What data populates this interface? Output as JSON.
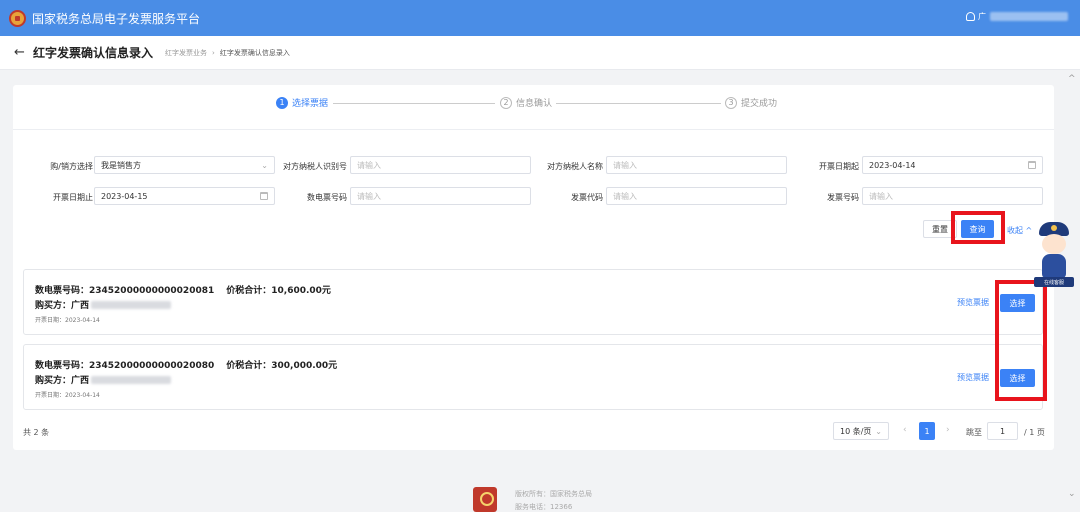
{
  "header": {
    "title": "国家税务总局电子发票服务平台",
    "user_prefix": "广"
  },
  "page": {
    "title": "红字发票确认信息录入",
    "breadcrumb": [
      "红字发票业务",
      "红字发票确认信息录入"
    ]
  },
  "steps": [
    {
      "num": "1",
      "label": "选择票据"
    },
    {
      "num": "2",
      "label": "信息确认"
    },
    {
      "num": "3",
      "label": "提交成功"
    }
  ],
  "form": {
    "buy_sell_label": "购/销方选择",
    "buy_sell_value": "我是销售方",
    "tax_id_label": "对方纳税人识别号",
    "tax_id_placeholder": "请输入",
    "name_label": "对方纳税人名称",
    "name_placeholder": "请输入",
    "date_start_label": "开票日期起",
    "date_start_value": "2023-04-14",
    "date_end_label": "开票日期止",
    "date_end_value": "2023-04-15",
    "einvoice_no_label": "数电票号码",
    "einvoice_no_placeholder": "请输入",
    "invoice_code_label": "发票代码",
    "invoice_code_placeholder": "请输入",
    "invoice_no_label": "发票号码",
    "invoice_no_placeholder": "请输入",
    "reset_label": "重置",
    "query_label": "查询",
    "collapse_label": "收起"
  },
  "records": [
    {
      "line1": "数电票号码：23452000000000020081",
      "total": "价税合计：10,600.00元",
      "buyer_label": "购买方：广西",
      "date": "开票日期：2023-04-14",
      "preview_label": "预览票据",
      "select_label": "选择"
    },
    {
      "line1": "数电票号码：23452000000000020080",
      "total": "价税合计：300,000.00元",
      "buyer_label": "购买方：广西",
      "date": "开票日期：2023-04-14",
      "preview_label": "预览票据",
      "select_label": "选择"
    }
  ],
  "pagination": {
    "total": "共 2 条",
    "page_size": "10 条/页",
    "current": "1",
    "jump_label": "跳至",
    "jump_value": "1",
    "total_pages": "/ 1 页"
  },
  "footer": {
    "copyright": "版权所有：国家税务总局",
    "hotline": "服务电话：12366"
  },
  "mascot": {
    "tag": "在线客服"
  },
  "colors": {
    "primary": "#3b82f6",
    "topbar": "#4a8de6",
    "highlight": "#e8141c"
  }
}
